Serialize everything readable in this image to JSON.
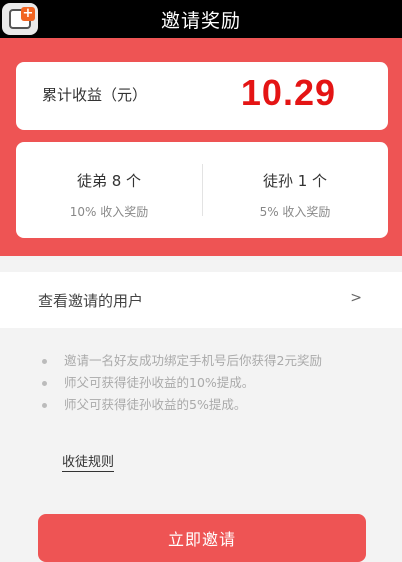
{
  "header": {
    "title": "邀请奖励"
  },
  "earnings": {
    "label": "累计收益（元）",
    "value": "10.29"
  },
  "stats": {
    "apprentice": {
      "count_label": "徒弟 8 个",
      "reward_label": "10% 收入奖励"
    },
    "grand_apprentice": {
      "count_label": "徒孙 1 个",
      "reward_label": "5% 收入奖励"
    }
  },
  "view_users": {
    "label": "查看邀请的用户",
    "chevron": ">"
  },
  "rules": {
    "items": [
      "邀请一名好友成功绑定手机号后你获得2元奖励",
      "师父可获得徒孙收益的10%提成。",
      "师父可获得徒孙收益的5%提成。"
    ],
    "link_label": "收徒规则"
  },
  "invite_button": {
    "label": "立即邀请"
  },
  "colors": {
    "accent_red": "#ee5454",
    "value_red": "#e41414"
  }
}
